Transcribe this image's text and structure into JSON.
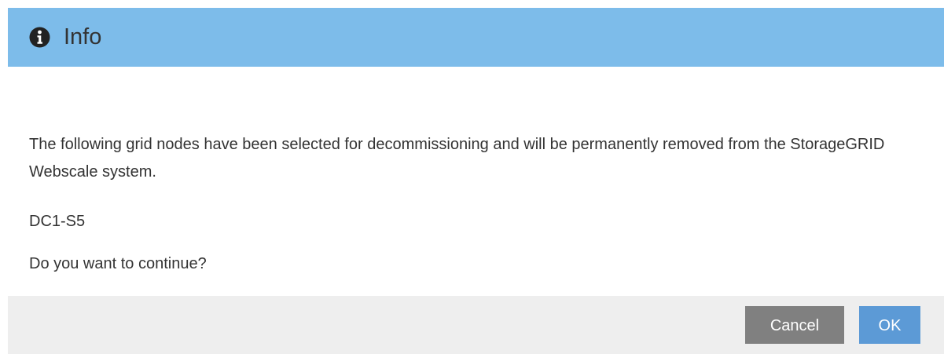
{
  "dialog": {
    "title": "Info",
    "icon": "info-circle-icon",
    "header_color": "#7dbcea",
    "message": "The following grid nodes have been selected for decommissioning and will be permanently removed from the StorageGRID Webscale system.",
    "nodes": [
      "DC1-S5"
    ],
    "question": "Do you want to continue?",
    "buttons": {
      "cancel_label": "Cancel",
      "ok_label": "OK"
    },
    "colors": {
      "cancel": "#808080",
      "ok": "#5c9ad6",
      "footer": "#eeeeee"
    }
  }
}
